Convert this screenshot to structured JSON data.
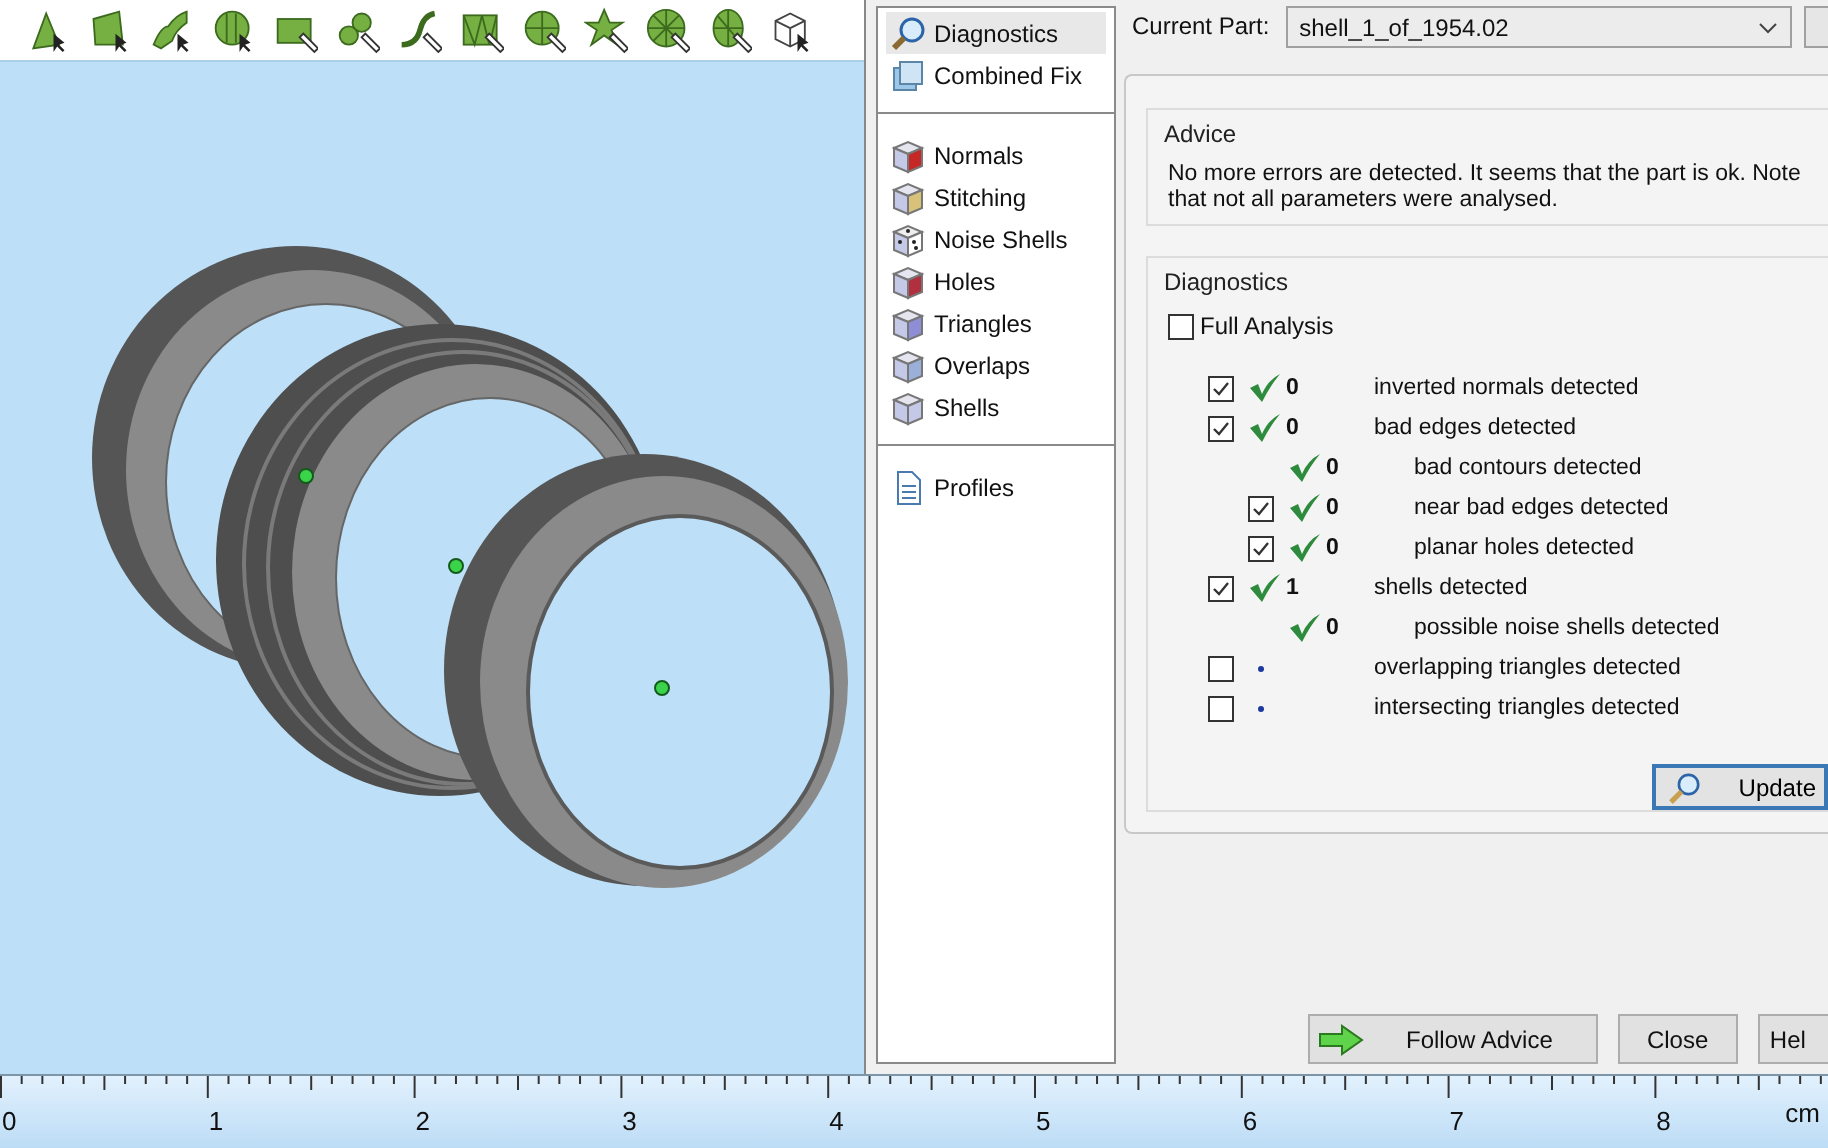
{
  "nav": [
    {
      "items": [
        {
          "label": "Diagnostics",
          "selected": true
        },
        {
          "label": "Combined Fix",
          "selected": false
        }
      ]
    },
    {
      "items": [
        {
          "label": "Normals",
          "selected": false
        },
        {
          "label": "Stitching",
          "selected": false
        },
        {
          "label": "Noise Shells",
          "selected": false
        },
        {
          "label": "Holes",
          "selected": false
        },
        {
          "label": "Triangles",
          "selected": false
        },
        {
          "label": "Overlaps",
          "selected": false
        },
        {
          "label": "Shells",
          "selected": false
        }
      ]
    },
    {
      "items": [
        {
          "label": "Profiles",
          "selected": false
        }
      ]
    }
  ],
  "current_part": {
    "label": "Current Part:",
    "value": "shell_1_of_1954.02"
  },
  "advice": {
    "title": "Advice",
    "text": "No more errors are detected. It seems that the part is ok. Note that not all parameters were analysed."
  },
  "diagnostics": {
    "title": "Diagnostics",
    "full_analysis": {
      "label": "Full Analysis",
      "checked": false
    },
    "rows": [
      {
        "kind": "checkbox",
        "checked": true,
        "passed": true,
        "count": "0",
        "label": "inverted normals detected"
      },
      {
        "kind": "checkbox",
        "checked": true,
        "passed": true,
        "count": "0",
        "label": "bad edges detected",
        "children": [
          {
            "kind": "plain",
            "passed": true,
            "count": "0",
            "label": "bad contours detected"
          },
          {
            "kind": "checkbox",
            "checked": true,
            "passed": true,
            "count": "0",
            "label": "near bad edges detected"
          },
          {
            "kind": "checkbox",
            "checked": true,
            "passed": true,
            "count": "0",
            "label": "planar holes detected"
          }
        ]
      },
      {
        "kind": "checkbox",
        "checked": true,
        "passed": true,
        "count": "1",
        "label": "shells detected",
        "children": [
          {
            "kind": "plain",
            "passed": true,
            "count": "0",
            "label": "possible noise shells detected"
          }
        ]
      },
      {
        "kind": "checkbox",
        "checked": false,
        "passed": false,
        "label": "overlapping triangles detected"
      },
      {
        "kind": "checkbox",
        "checked": false,
        "passed": false,
        "label": "intersecting triangles detected"
      }
    ],
    "update_button": "Update"
  },
  "buttons": [
    "Follow Advice",
    "Close",
    "Hel"
  ],
  "ruler": {
    "labels": [
      "0",
      "1",
      "2",
      "3",
      "4",
      "5",
      "6",
      "7",
      "8"
    ],
    "unit": "cm"
  }
}
